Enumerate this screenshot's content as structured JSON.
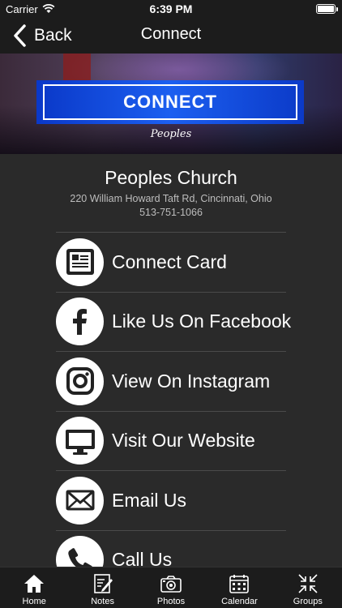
{
  "status_bar": {
    "carrier": "Carrier",
    "time": "6:39 PM"
  },
  "nav": {
    "back_label": "Back",
    "title": "Connect"
  },
  "banner": {
    "button_text": "CONNECT",
    "logo_text": "Peoples"
  },
  "church": {
    "name": "Peoples Church",
    "address": "220 William Howard Taft Rd, Cincinnati, Ohio",
    "phone": "513-751-1066"
  },
  "links": [
    {
      "label": "Connect Card",
      "icon": "form-icon"
    },
    {
      "label": "Like Us On Facebook",
      "icon": "facebook-icon"
    },
    {
      "label": "View On Instagram",
      "icon": "instagram-icon"
    },
    {
      "label": "Visit Our Website",
      "icon": "monitor-icon"
    },
    {
      "label": "Email Us",
      "icon": "envelope-icon"
    },
    {
      "label": "Call Us",
      "icon": "phone-icon"
    }
  ],
  "tabs": [
    {
      "label": "Home",
      "icon": "home-icon"
    },
    {
      "label": "Notes",
      "icon": "notes-icon"
    },
    {
      "label": "Photos",
      "icon": "camera-icon"
    },
    {
      "label": "Calendar",
      "icon": "calendar-icon"
    },
    {
      "label": "Groups",
      "icon": "groups-icon"
    }
  ]
}
